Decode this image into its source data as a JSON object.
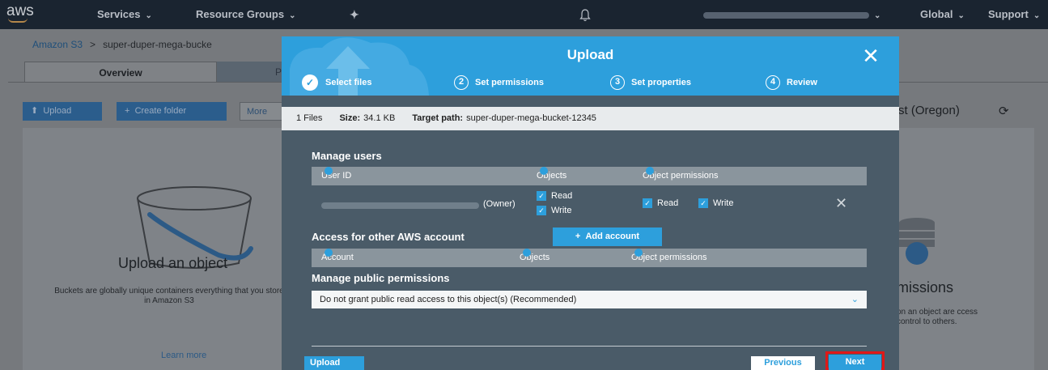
{
  "topnav": {
    "logo": "aws",
    "services": "Services",
    "resource_groups": "Resource Groups",
    "global": "Global",
    "support": "Support"
  },
  "background": {
    "breadcrumb": {
      "root": "Amazon S3",
      "separator": ">",
      "bucket": "super-duper-mega-bucke"
    },
    "tabs": {
      "overview": "Overview",
      "other": "P"
    },
    "buttons": {
      "upload": "Upload",
      "create_folder": "Create folder",
      "more": "More"
    },
    "region": "st (Oregon)",
    "upload_card": {
      "title": "Upload an object",
      "description": "Buckets are globally unique containers everything that you store in Amazon S3",
      "link": "Learn more"
    },
    "permissions_card": {
      "title": "missions",
      "description": "on an object are ccess control to others."
    }
  },
  "modal": {
    "title": "Upload",
    "steps": [
      {
        "number": "",
        "label": "Select files",
        "state": "complete"
      },
      {
        "number": "2",
        "label": "Set permissions",
        "state": "active"
      },
      {
        "number": "3",
        "label": "Set properties",
        "state": "pending"
      },
      {
        "number": "4",
        "label": "Review",
        "state": "pending"
      }
    ],
    "summary": {
      "files": "1 Files",
      "size_label": "Size:",
      "size_value": "34.1 KB",
      "target_label": "Target path:",
      "target_value": "super-duper-mega-bucket-12345"
    },
    "manage_users": {
      "title": "Manage users",
      "columns": {
        "user_id": "User ID",
        "objects": "Objects",
        "object_permissions": "Object permissions"
      },
      "row": {
        "owner_suffix": "(Owner)",
        "objects_read": "Read",
        "objects_write": "Write",
        "perm_read": "Read",
        "perm_write": "Write"
      }
    },
    "other_accounts": {
      "title": "Access for other AWS account",
      "add_button": "Add account",
      "columns": {
        "account": "Account",
        "objects": "Objects",
        "object_permissions": "Object permissions"
      }
    },
    "public_permissions": {
      "title": "Manage public permissions",
      "selected": "Do not grant public read access to this object(s) (Recommended)"
    },
    "footer": {
      "upload": "Upload",
      "previous": "Previous",
      "next": "Next"
    }
  },
  "colors": {
    "nav_bg": "#1a2430",
    "modal_header": "#2d9fdc",
    "modal_body": "#4a5b68",
    "highlight": "#e01818"
  }
}
